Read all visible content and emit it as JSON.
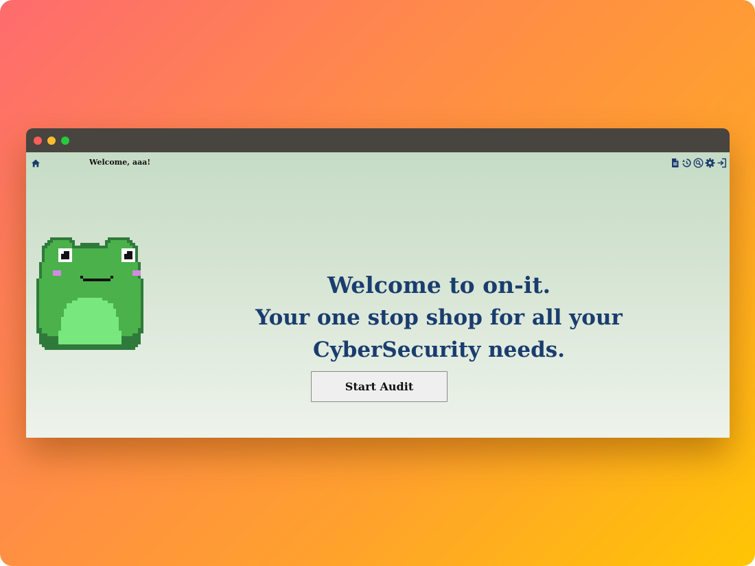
{
  "colors": {
    "heading": "#1a3d6e",
    "icon": "#1a3d6e",
    "titlebar": "#48443f",
    "frog_dark": "#2f7a3b",
    "frog_body": "#4bb14b",
    "frog_belly": "#77e77e",
    "frog_blush": "#d08be0"
  },
  "nav": {
    "home_icon": "home-icon",
    "greeting": "Welcome, aaa!",
    "icons": [
      "document-icon",
      "history-icon",
      "search-icon",
      "gear-icon",
      "logout-icon"
    ]
  },
  "hero": {
    "title": "Welcome to on-it.",
    "subtitle": "Your one stop shop for all your CyberSecurity needs."
  },
  "actions": {
    "start_audit": "Start Audit"
  },
  "mascot": {
    "icon": "pixel-frog-icon"
  }
}
